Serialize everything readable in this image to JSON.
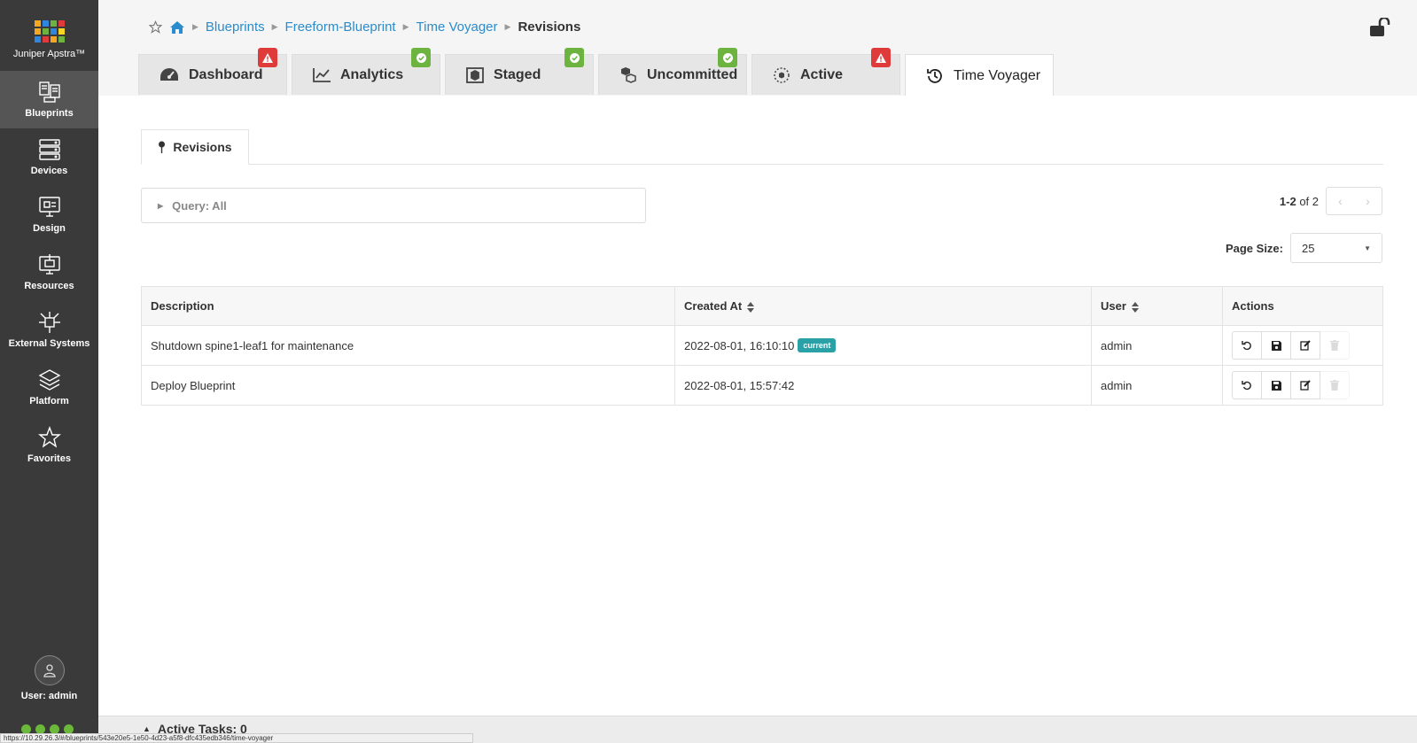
{
  "brand": {
    "name": "Juniper Apstra™",
    "logo_colors": [
      "#f5a623",
      "#2e86de",
      "#6cb33f",
      "#e03b3b",
      "#f5a623",
      "#6cb33f",
      "#2e86de",
      "#f5d623",
      "#2e86de",
      "#e03b3b",
      "#f5a623",
      "#6cb33f"
    ]
  },
  "sidebar": {
    "items": [
      {
        "label": "Blueprints",
        "icon": "blueprints-icon",
        "active": true
      },
      {
        "label": "Devices",
        "icon": "devices-icon",
        "active": false
      },
      {
        "label": "Design",
        "icon": "design-icon",
        "active": false
      },
      {
        "label": "Resources",
        "icon": "resources-icon",
        "active": false
      },
      {
        "label": "External Systems",
        "icon": "external-systems-icon",
        "active": false
      },
      {
        "label": "Platform",
        "icon": "platform-icon",
        "active": false
      },
      {
        "label": "Favorites",
        "icon": "star-icon",
        "active": false
      }
    ],
    "user_label": "User: admin"
  },
  "breadcrumb": {
    "items": [
      "Blueprints",
      "Freeform-Blueprint",
      "Time Voyager"
    ],
    "current": "Revisions"
  },
  "tabs": [
    {
      "label": "Dashboard",
      "icon": "dashboard-icon",
      "badge": "warning"
    },
    {
      "label": "Analytics",
      "icon": "analytics-icon",
      "badge": "ok"
    },
    {
      "label": "Staged",
      "icon": "staged-icon",
      "badge": "ok"
    },
    {
      "label": "Uncommitted",
      "icon": "uncommitted-icon",
      "badge": "ok"
    },
    {
      "label": "Active",
      "icon": "active-icon",
      "badge": "warning"
    },
    {
      "label": "Time Voyager",
      "icon": "history-icon",
      "badge": null,
      "active": true
    }
  ],
  "colors": {
    "sidebar_bg": "#3a3a3a",
    "link": "#2a8ccc",
    "warning": "#e03b3b",
    "ok": "#6cb33f",
    "current_badge": "#2aa1a7"
  },
  "subtab": {
    "label": "Revisions"
  },
  "query": {
    "label": "Query: All"
  },
  "pagination": {
    "range": "1-2",
    "of_text": "of 2"
  },
  "page_size": {
    "label": "Page Size:",
    "value": "25"
  },
  "table": {
    "headers": {
      "description": "Description",
      "created_at": "Created At",
      "user": "User",
      "actions": "Actions"
    },
    "rows": [
      {
        "description": "Shutdown spine1-leaf1 for maintenance",
        "created_at": "2022-08-01, 16:10:10",
        "badge": "current",
        "user": "admin"
      },
      {
        "description": "Deploy Blueprint",
        "created_at": "2022-08-01, 15:57:42",
        "badge": null,
        "user": "admin"
      }
    ]
  },
  "footer": {
    "active_tasks": "Active Tasks: 0"
  },
  "status_url": "https://10.29.26.3/#/blueprints/543e20e5-1e50-4d23-a5f8-dfc435edb346/time-voyager"
}
